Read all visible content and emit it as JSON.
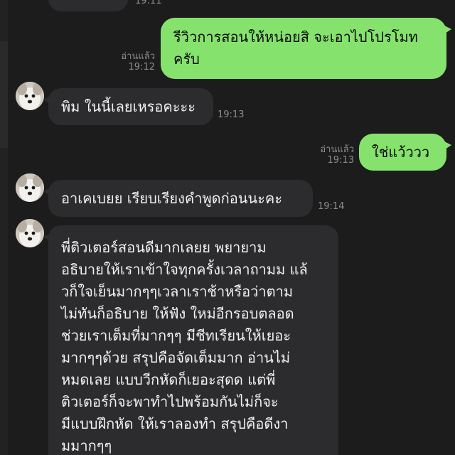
{
  "chat": {
    "top_partial": {
      "time": "19:11"
    },
    "messages": [
      {
        "id": "m1",
        "dir": "out",
        "text": "รีวิวการสอนให้หน่อยสิ จะเอาไปโปรโมท\nครับ",
        "read": "อ่านแล้ว",
        "time": "19:12"
      },
      {
        "id": "m2",
        "dir": "in",
        "text": "พิม ในนี้เลยเหรอคะะะ",
        "time": "19:13"
      },
      {
        "id": "m3",
        "dir": "out",
        "text": "ใช่แว้ววว",
        "read": "อ่านแล้ว",
        "time": "19:13"
      },
      {
        "id": "m4",
        "dir": "in",
        "text": "อาเคเบยย เรียบเรียงคำพูดก่อนนะคะ",
        "time": "19:14"
      },
      {
        "id": "m5",
        "dir": "in",
        "text": "พี่ติวเตอร์สอนดีมากเลยย พยายาม\nอธิบายให้เราเข้าใจทุกครั้งเวลาถามม แล้\nวก็ใจเย็นมากๆๆเวลาเราช้าหรือว่าตาม\nไม่ทันก็อธิบาย ให้ฟัง ใหม่อีกรอบตลอด\nช่วยเราเต็มที่มากๆๆ มีชีทเรียนให้เยอะ\nมากๆๆด้วย สรุปคือจัดเต็มมาก อ่านไม่\nหมดเลย แบบวีกหัดก็เยอะสุดด แต่พี่\nติวเตอร์ก็จะพาทำไปพร้อมกันไม่ก็จะ\nมีแบบฝึกหัด ให้เราลองทำ สรุปคือดีงา\nมมากๆๆ"
      }
    ]
  },
  "colors": {
    "background": "#1c1c1d",
    "incoming_bubble": "#2c2c2e",
    "outgoing_bubble": "#85e36d",
    "meta_text": "#8d8d90"
  }
}
